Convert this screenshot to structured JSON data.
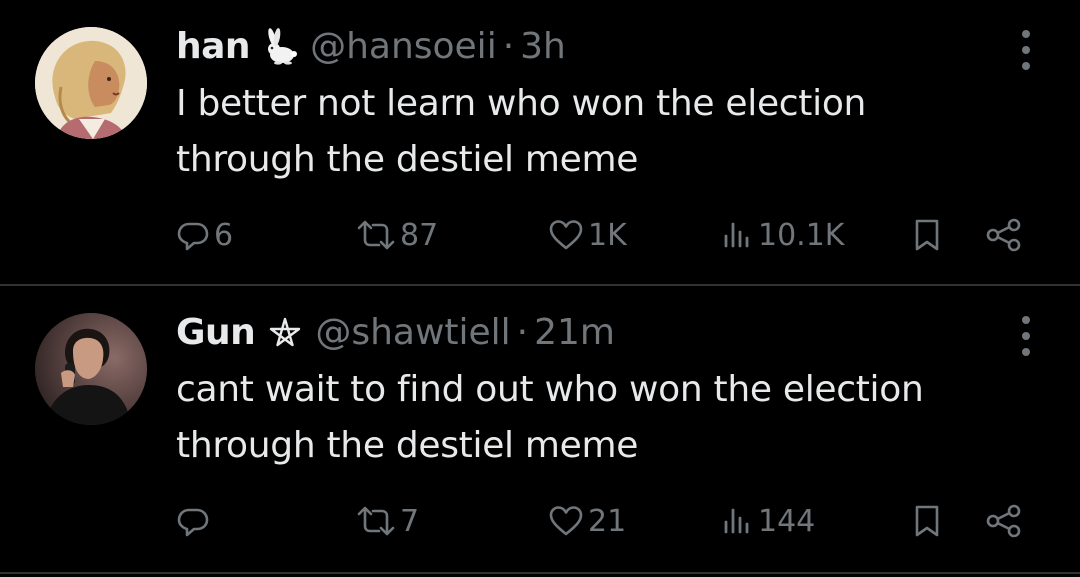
{
  "tweets": [
    {
      "display_name": "han",
      "name_emoji": "rabbit-emoji-icon",
      "handle": "@hansoeii",
      "separator": "·",
      "time": "3h",
      "text_lines": [
        "I better not learn who won the election",
        "through the destiel meme"
      ],
      "replies": "6",
      "retweets": "87",
      "likes": "1K",
      "views": "10.1K"
    },
    {
      "display_name": "Gun",
      "name_emoji": "pentagram-icon",
      "handle": "@shawtiell",
      "separator": "·",
      "time": "21m",
      "text_lines": [
        "cant wait to find out who won the election",
        "through the destiel meme"
      ],
      "replies": "",
      "retweets": "7",
      "likes": "21",
      "views": "144"
    }
  ],
  "colors": {
    "background": "#000000",
    "text_primary": "#e7e9ea",
    "text_secondary": "#71767b",
    "divider": "#2f3336"
  }
}
